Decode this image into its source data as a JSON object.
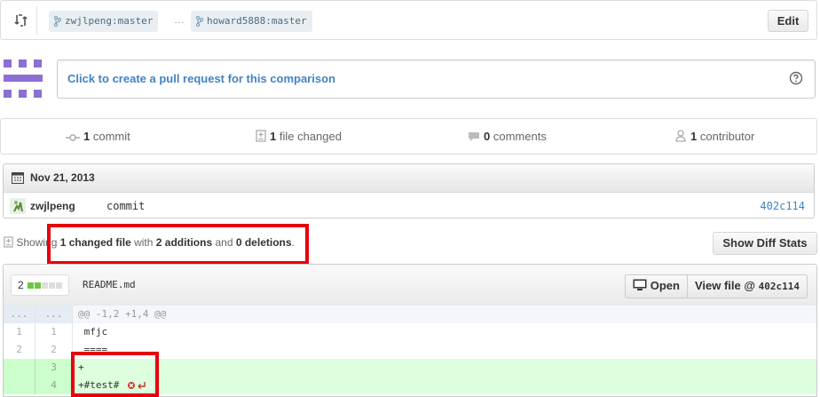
{
  "compare": {
    "base_branch": "zwjlpeng:master",
    "ellipsis": "…",
    "head_branch": "howard5888:master",
    "edit_label": "Edit"
  },
  "pull_request": {
    "prompt": "Click to create a pull request for this comparison"
  },
  "stats": {
    "commits_count": "1",
    "commits_label": "commit",
    "files_count": "1",
    "files_label": "file changed",
    "comments_count": "0",
    "comments_label": "comments",
    "contributors_count": "1",
    "contributors_label": "contributor"
  },
  "commit_group": {
    "date": "Nov 21, 2013",
    "author": "zwjlpeng",
    "message": "commit",
    "sha": "402c114"
  },
  "summary": {
    "prefix": "Showing",
    "changed": "1 changed file",
    "with": "with",
    "additions": "2 additions",
    "and": "and",
    "deletions": "0 deletions",
    "suffix": ".",
    "show_diff_stats_label": "Show Diff Stats"
  },
  "file": {
    "diffstat_count": "2",
    "name": "README.md",
    "open_label": "Open",
    "view_file_label": "View file @",
    "view_file_sha": "402c114",
    "lines": [
      {
        "type": "hunk",
        "old": "...",
        "new": "...",
        "text": "@@ -1,2 +1,4 @@"
      },
      {
        "type": "context",
        "old": "1",
        "new": "1",
        "text": " mfjc"
      },
      {
        "type": "context",
        "old": "2",
        "new": "2",
        "text": " ===="
      },
      {
        "type": "add",
        "old": "",
        "new": "3",
        "text": "+"
      },
      {
        "type": "add",
        "old": "",
        "new": "4",
        "text": "+#test#"
      }
    ]
  },
  "colors": {
    "link": "#4183c4",
    "highlight_box": "#e8000c",
    "addition_bg": "#ddffdd",
    "diffstat_add": "#6cc644",
    "diffstat_neutral": "#dddddd"
  }
}
